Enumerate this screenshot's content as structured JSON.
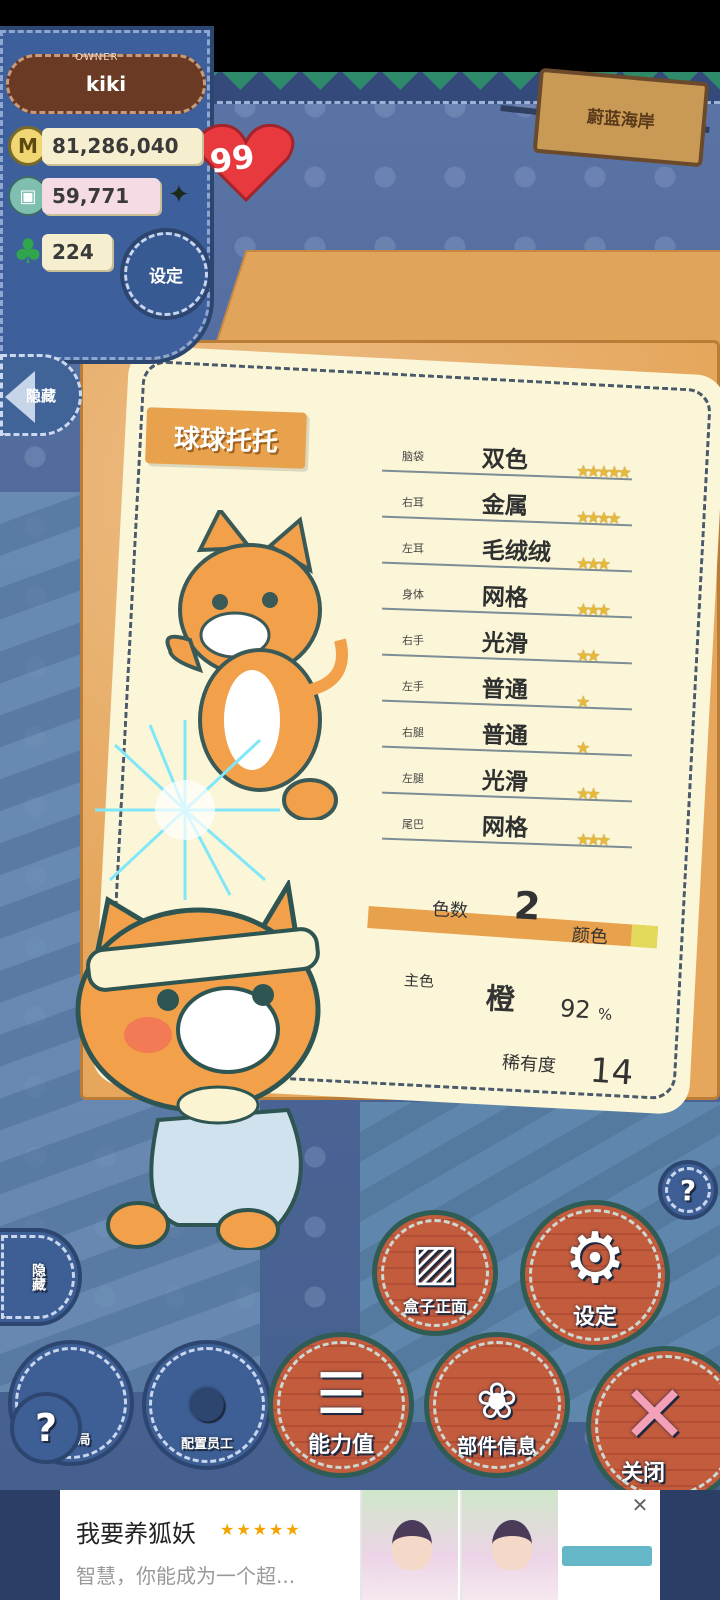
{
  "owner": {
    "caption": "OWNER",
    "name": "kiki",
    "level": "99"
  },
  "resources": {
    "money": "81,286,040",
    "crates": "59,771",
    "clover": "224"
  },
  "sign": {
    "text": "蔚蓝海岸"
  },
  "buttons": {
    "settings_small": "设定",
    "hide_top": "隐藏",
    "hide_bottom": "隐藏",
    "box_front": "盒子正面",
    "settings": "设定",
    "ability": "能力值",
    "parts_info": "部件信息",
    "close": "关闭",
    "layout": "放布局",
    "staff": "配置员工",
    "help": "?"
  },
  "toy": {
    "name": "球球托托",
    "parts": [
      {
        "label": "脑袋",
        "value": "双色",
        "stars": 5
      },
      {
        "label": "右耳",
        "value": "金属",
        "stars": 4
      },
      {
        "label": "左耳",
        "value": "毛绒绒",
        "stars": 3
      },
      {
        "label": "身体",
        "value": "网格",
        "stars": 3
      },
      {
        "label": "右手",
        "value": "光滑",
        "stars": 2
      },
      {
        "label": "左手",
        "value": "普通",
        "stars": 1
      },
      {
        "label": "右腿",
        "value": "普通",
        "stars": 1
      },
      {
        "label": "左腿",
        "value": "光滑",
        "stars": 2
      },
      {
        "label": "尾巴",
        "value": "网格",
        "stars": 3
      }
    ],
    "color_count_label": "色数",
    "color_count": "2",
    "color_count_unit": "颜色",
    "main_color_label": "主色",
    "main_color": "橙",
    "main_color_pct": "92",
    "pct_unit": "%",
    "rarity_label": "稀有度",
    "rarity": "14"
  },
  "ad": {
    "title": "我要养狐妖",
    "stars": "★★★★★",
    "desc": "智慧，你能成为一个超...",
    "close": "✕"
  },
  "colors": {
    "board": "#e6a75d",
    "card": "#fbf6d8",
    "brick": "#c35b3d"
  }
}
